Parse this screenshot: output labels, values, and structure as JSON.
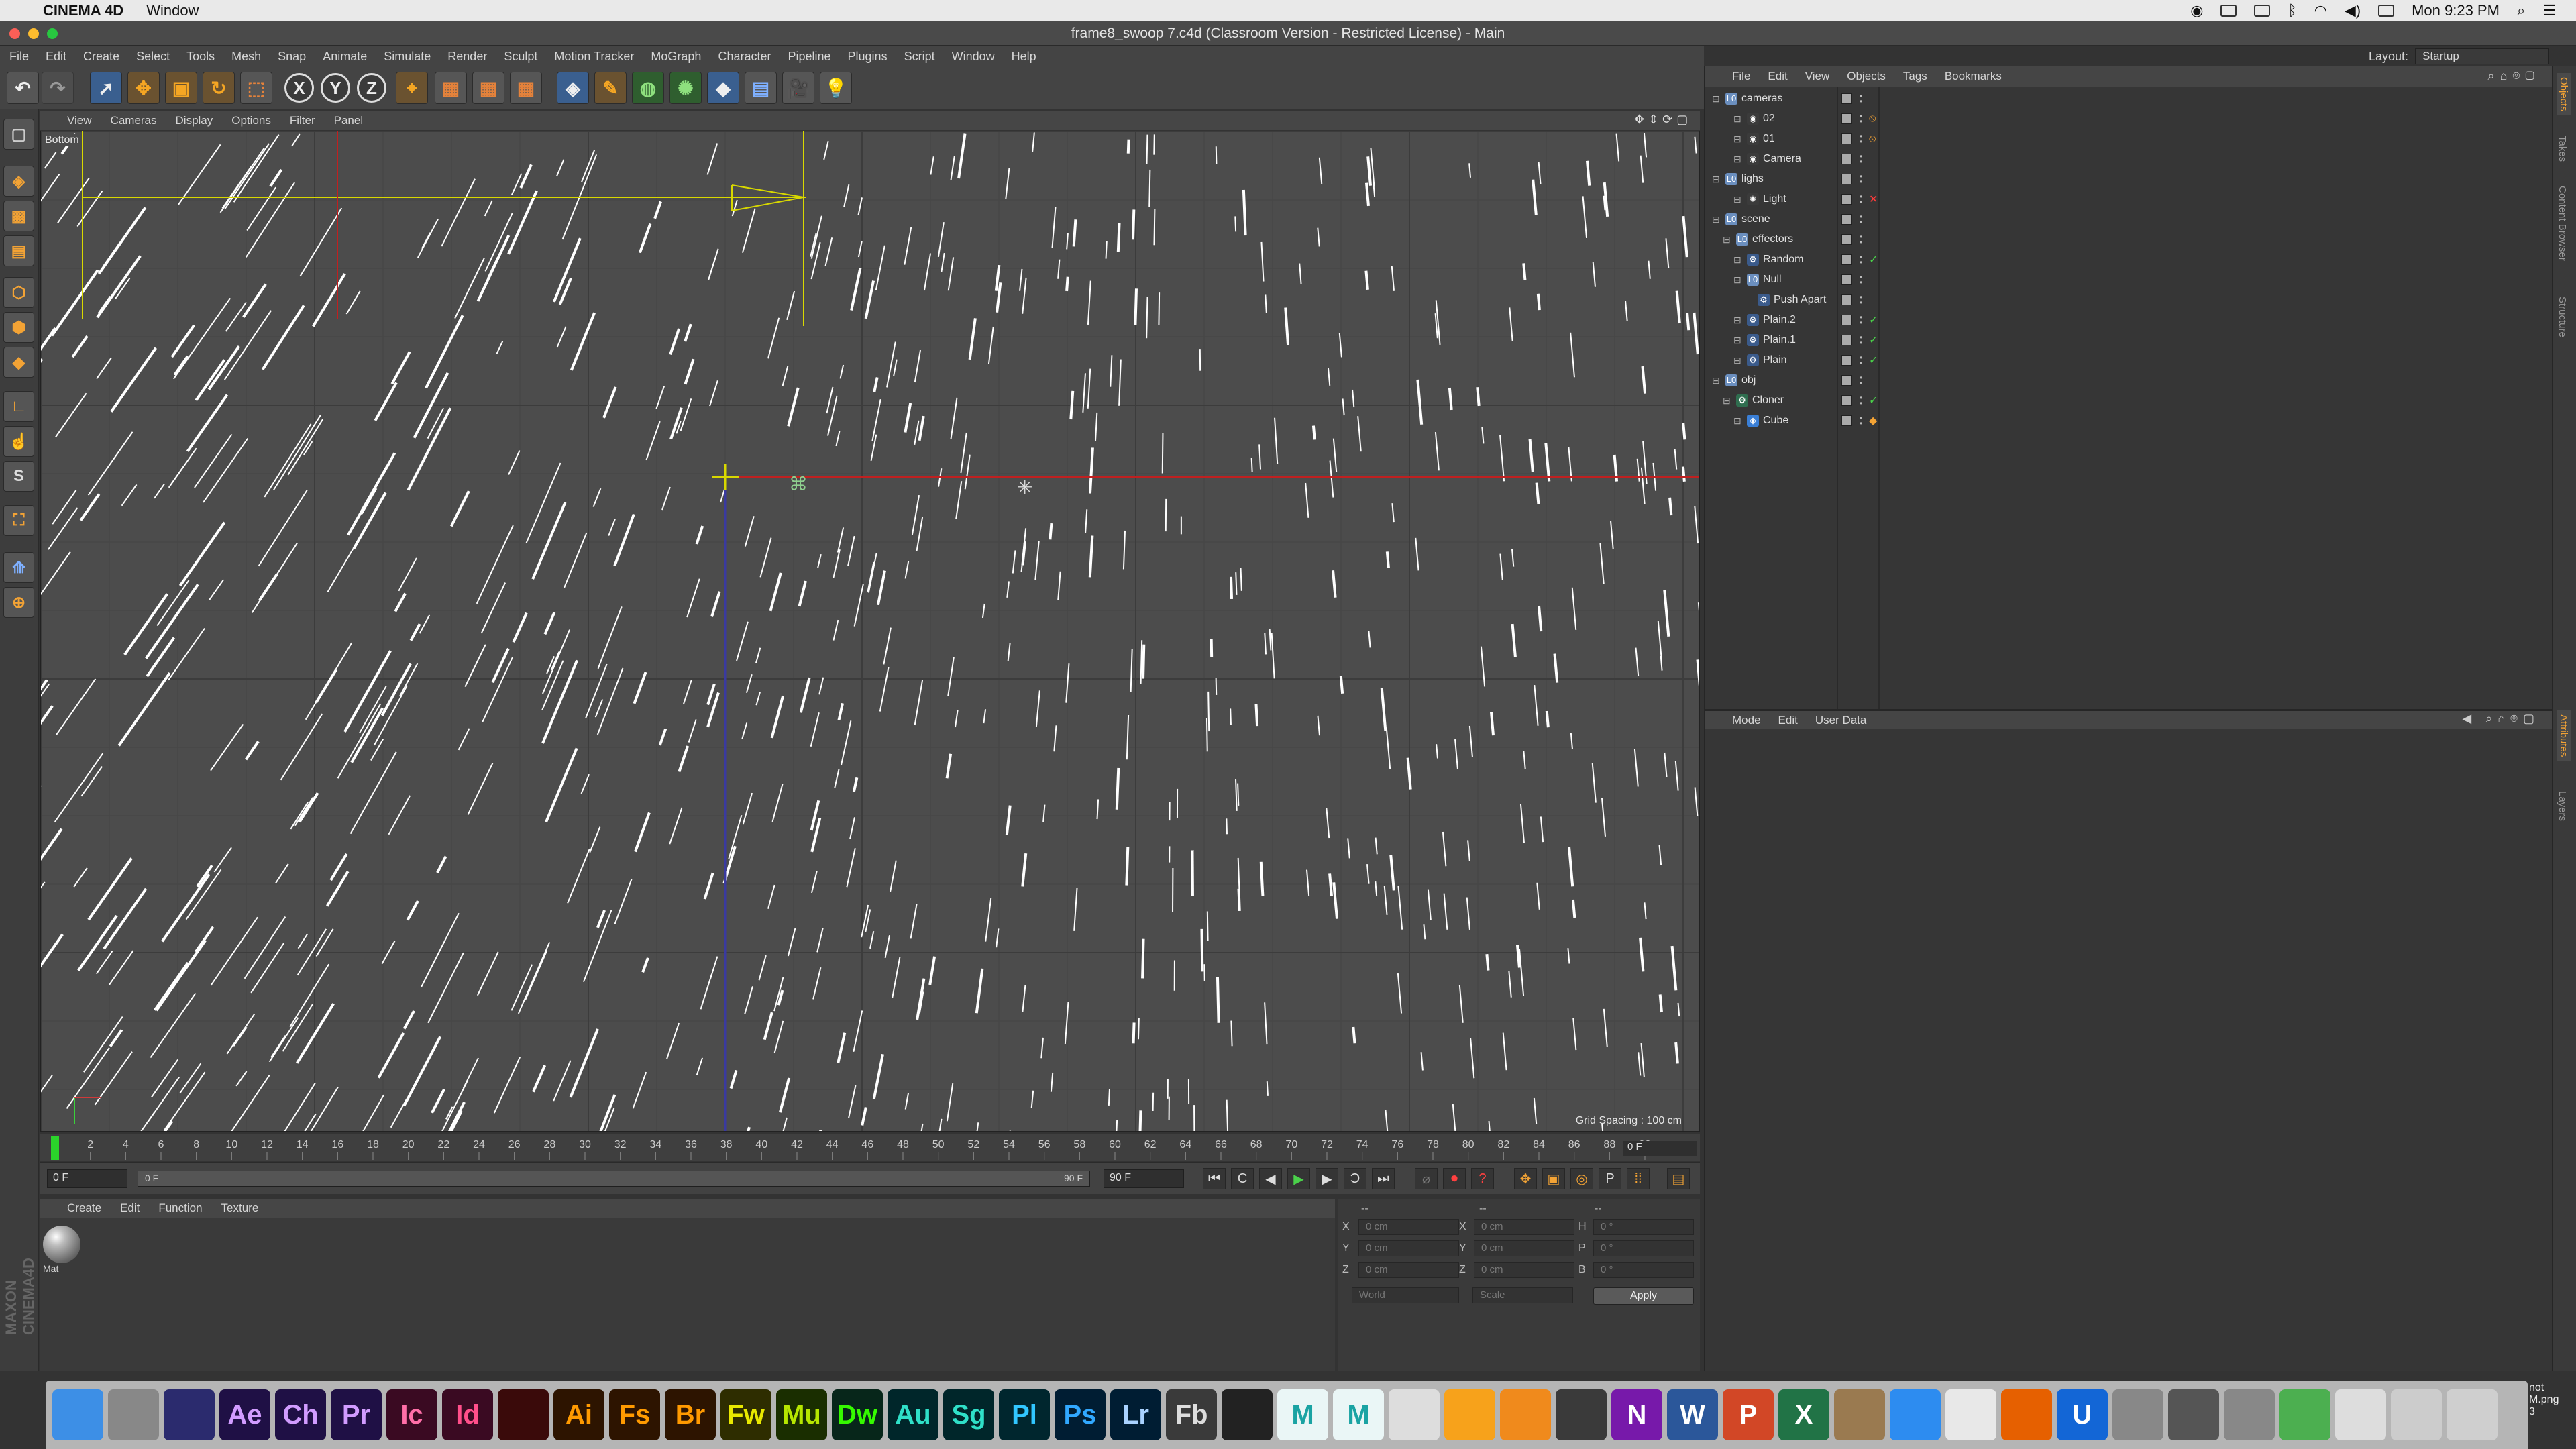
{
  "menubar": {
    "app_name": "CINEMA 4D",
    "window_menu": "Window",
    "clock": "Mon 9:23 PM"
  },
  "window": {
    "title": "frame8_swoop 7.c4d (Classroom Version - Restricted License) - Main"
  },
  "main_menu": [
    "File",
    "Edit",
    "Create",
    "Select",
    "Tools",
    "Mesh",
    "Snap",
    "Animate",
    "Simulate",
    "Render",
    "Sculpt",
    "Motion Tracker",
    "MoGraph",
    "Character",
    "Pipeline",
    "Plugins",
    "Script",
    "Window",
    "Help"
  ],
  "layout": {
    "label": "Layout:",
    "value": "Startup"
  },
  "toolbar": {
    "x": "X",
    "y": "Y",
    "z": "Z"
  },
  "viewport": {
    "menu": [
      "View",
      "Cameras",
      "Display",
      "Options",
      "Filter",
      "Panel"
    ],
    "label": "Bottom",
    "grid_spacing": "Grid Spacing : 100 cm"
  },
  "timeline": {
    "ticks": [
      "0",
      "2",
      "4",
      "6",
      "8",
      "10",
      "12",
      "14",
      "16",
      "18",
      "20",
      "22",
      "24",
      "26",
      "28",
      "30",
      "32",
      "34",
      "36",
      "38",
      "40",
      "42",
      "44",
      "46",
      "48",
      "50",
      "52",
      "54",
      "56",
      "58",
      "60",
      "62",
      "64",
      "66",
      "68",
      "70",
      "72",
      "74",
      "76",
      "78",
      "80",
      "82",
      "84",
      "86",
      "88",
      "90"
    ],
    "current_frame": "0 F",
    "end_label": "0 F"
  },
  "transport": {
    "start": "0 F",
    "range_start": "0 F",
    "range_end": "90 F",
    "end": "90 F"
  },
  "material": {
    "menu": [
      "Create",
      "Edit",
      "Function",
      "Texture"
    ],
    "name": "Mat"
  },
  "coords": {
    "header_left": "--",
    "header_mid": "--",
    "header_right": "--",
    "rows": [
      {
        "a": "X",
        "av": "0 cm",
        "b": "X",
        "bv": "0 cm",
        "c": "H",
        "cv": "0 °"
      },
      {
        "a": "Y",
        "av": "0 cm",
        "b": "Y",
        "bv": "0 cm",
        "c": "P",
        "cv": "0 °"
      },
      {
        "a": "Z",
        "av": "0 cm",
        "b": "Z",
        "bv": "0 cm",
        "c": "B",
        "cv": "0 °"
      }
    ],
    "mode1": "World",
    "mode2": "Scale",
    "apply": "Apply"
  },
  "maxon": "MAXON CINEMA4D",
  "objects": {
    "menu": [
      "File",
      "Edit",
      "View",
      "Objects",
      "Tags",
      "Bookmarks"
    ],
    "items": [
      {
        "name": "cameras",
        "indent": 0,
        "icon": "null-icon",
        "tags": ""
      },
      {
        "name": "02",
        "indent": 2,
        "icon": "camera-icon",
        "tags": "protect"
      },
      {
        "name": "01",
        "indent": 2,
        "icon": "camera-icon",
        "tags": "protect"
      },
      {
        "name": "Camera",
        "indent": 2,
        "icon": "camera-icon",
        "tags": ""
      },
      {
        "name": "lighs",
        "indent": 0,
        "icon": "null-icon",
        "tags": ""
      },
      {
        "name": "Light",
        "indent": 2,
        "icon": "light-icon",
        "tags": "x"
      },
      {
        "name": "scene",
        "indent": 0,
        "icon": "null-icon",
        "tags": ""
      },
      {
        "name": "effectors",
        "indent": 1,
        "icon": "null-icon",
        "tags": ""
      },
      {
        "name": "Random",
        "indent": 2,
        "icon": "effector-icon",
        "tags": "check"
      },
      {
        "name": "Null",
        "indent": 2,
        "icon": "null-icon",
        "tags": ""
      },
      {
        "name": "Push Apart",
        "indent": 3,
        "icon": "effector-icon",
        "tags": ""
      },
      {
        "name": "Plain.2",
        "indent": 2,
        "icon": "effector-icon",
        "tags": "check"
      },
      {
        "name": "Plain.1",
        "indent": 2,
        "icon": "effector-icon",
        "tags": "check"
      },
      {
        "name": "Plain",
        "indent": 2,
        "icon": "effector-icon",
        "tags": "check"
      },
      {
        "name": "obj",
        "indent": 0,
        "icon": "null-icon",
        "tags": ""
      },
      {
        "name": "Cloner",
        "indent": 1,
        "icon": "cloner-icon",
        "tags": "check"
      },
      {
        "name": "Cube",
        "indent": 2,
        "icon": "cube-icon",
        "tags": "material"
      }
    ]
  },
  "attributes": {
    "menu": [
      "Mode",
      "Edit",
      "User Data"
    ]
  },
  "side_tabs": [
    "Objects",
    "Takes",
    "Content Browser",
    "Structure"
  ],
  "side_tabs2": [
    "Attributes",
    "Layers"
  ],
  "dock": [
    {
      "label": "",
      "icon": "finder-icon",
      "bg": "#3d8fe6",
      "fg": "#fff"
    },
    {
      "label": "",
      "icon": "launchpad-icon",
      "bg": "#888",
      "fg": "#fff"
    },
    {
      "label": "",
      "icon": "cinema4d-app-icon",
      "bg": "#2b2b6e",
      "fg": "#fff"
    },
    {
      "label": "Ae",
      "icon": "after-effects-icon",
      "bg": "#1f1045",
      "fg": "#d19cff"
    },
    {
      "label": "Ch",
      "icon": "character-animator-icon",
      "bg": "#1f1045",
      "fg": "#d19cff"
    },
    {
      "label": "Pr",
      "icon": "premiere-icon",
      "bg": "#1f1045",
      "fg": "#d19cff"
    },
    {
      "label": "Ic",
      "icon": "incopy-icon",
      "bg": "#3a0a22",
      "fg": "#ff6fa8"
    },
    {
      "label": "Id",
      "icon": "indesign-icon",
      "bg": "#3a0a22",
      "fg": "#ff4f8a"
    },
    {
      "label": "",
      "icon": "acrobat-icon",
      "bg": "#3a0a0a",
      "fg": "#ff4444"
    },
    {
      "label": "Ai",
      "icon": "illustrator-icon",
      "bg": "#2d1400",
      "fg": "#ff9a00"
    },
    {
      "label": "Fs",
      "icon": "fuse-icon",
      "bg": "#2d1400",
      "fg": "#ff9a00"
    },
    {
      "label": "Br",
      "icon": "bridge-icon",
      "bg": "#2d1400",
      "fg": "#ff9a00"
    },
    {
      "label": "Fw",
      "icon": "fireworks-icon",
      "bg": "#2e2d00",
      "fg": "#e8e800"
    },
    {
      "label": "Mu",
      "icon": "muse-icon",
      "bg": "#1a2e00",
      "fg": "#b6e600"
    },
    {
      "label": "Dw",
      "icon": "dreamweaver-icon",
      "bg": "#07261a",
      "fg": "#35fa00"
    },
    {
      "label": "Au",
      "icon": "audition-icon",
      "bg": "#00262a",
      "fg": "#2fe0c8"
    },
    {
      "label": "Sg",
      "icon": "speedgrade-icon",
      "bg": "#00262a",
      "fg": "#2fe0c8"
    },
    {
      "label": "Pl",
      "icon": "prelude-icon",
      "bg": "#00262e",
      "fg": "#31c6ff"
    },
    {
      "label": "Ps",
      "icon": "photoshop-icon",
      "bg": "#001d33",
      "fg": "#31a8ff"
    },
    {
      "label": "Lr",
      "icon": "lightroom-icon",
      "bg": "#001d33",
      "fg": "#a9d2ff"
    },
    {
      "label": "Fb",
      "icon": "flash-builder-icon",
      "bg": "#3a3a3a",
      "fg": "#ddd"
    },
    {
      "label": "",
      "icon": "cinema4d-dock-icon",
      "bg": "#222",
      "fg": "#7fb0ff"
    },
    {
      "label": "M",
      "icon": "maya-icon",
      "bg": "#eaf6f6",
      "fg": "#1aa3a3"
    },
    {
      "label": "M",
      "icon": "mudbox-icon",
      "bg": "#eaf6f6",
      "fg": "#1aa3a3"
    },
    {
      "label": "",
      "icon": "pencil-icon",
      "bg": "#ddd",
      "fg": "#555"
    },
    {
      "label": "",
      "icon": "pages-icon",
      "bg": "#f7a21b",
      "fg": "#fff"
    },
    {
      "label": "",
      "icon": "ibooks-icon",
      "bg": "#f08a1c",
      "fg": "#fff"
    },
    {
      "label": "",
      "icon": "screen-icon",
      "bg": "#3a3a3a",
      "fg": "#fff"
    },
    {
      "label": "N",
      "icon": "onenote-icon",
      "bg": "#7719aa",
      "fg": "#fff"
    },
    {
      "label": "W",
      "icon": "word-icon",
      "bg": "#2b579a",
      "fg": "#fff"
    },
    {
      "label": "P",
      "icon": "powerpoint-icon",
      "bg": "#d24726",
      "fg": "#fff"
    },
    {
      "label": "X",
      "icon": "excel-icon",
      "bg": "#217346",
      "fg": "#fff"
    },
    {
      "label": "",
      "icon": "creature-icon",
      "bg": "#9a7a50",
      "fg": "#fff"
    },
    {
      "label": "",
      "icon": "safari-icon",
      "bg": "#2d8cf0",
      "fg": "#fff"
    },
    {
      "label": "",
      "icon": "chrome-icon",
      "bg": "#e8e8e8",
      "fg": "#e04030"
    },
    {
      "label": "",
      "icon": "firefox-icon",
      "bg": "#e66000",
      "fg": "#fff"
    },
    {
      "label": "U",
      "icon": "unity-icon",
      "bg": "#1366d6",
      "fg": "#fff"
    },
    {
      "label": "",
      "icon": "disk-utility-icon",
      "bg": "#888",
      "fg": "#fff"
    },
    {
      "label": "",
      "icon": "camera-app-icon",
      "bg": "#555",
      "fg": "#fff"
    },
    {
      "label": "",
      "icon": "system-preferences-icon",
      "bg": "#888",
      "fg": "#fff"
    },
    {
      "label": "",
      "icon": "android-icon",
      "bg": "#4caf50",
      "fg": "#fff"
    },
    {
      "label": "",
      "icon": "folder-icon",
      "bg": "#ddd",
      "fg": "#555"
    },
    {
      "label": "",
      "icon": "documents-stack-icon",
      "bg": "#ccc",
      "fg": "#555"
    },
    {
      "label": "",
      "icon": "trash-icon",
      "bg": "#cfcfcf",
      "fg": "#777"
    }
  ],
  "desktop_file": "not\nM.png\n3"
}
